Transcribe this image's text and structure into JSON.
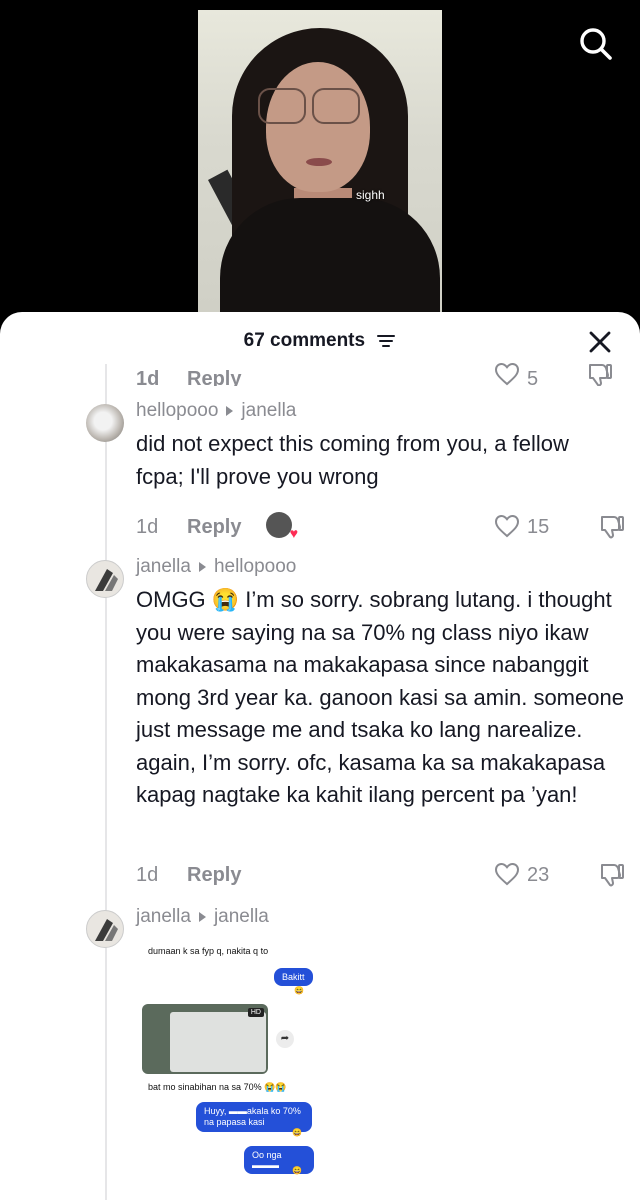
{
  "video": {
    "caption": "sighh"
  },
  "icons": {
    "search": "search-icon",
    "close": "close-icon",
    "filter": "filter-icon",
    "heart": "heart-icon",
    "dislike": "dislike-icon"
  },
  "colors": {
    "accent": "#fe2c55",
    "muted": "#8a8b91",
    "text": "#161823",
    "message_out": "#2450d8"
  },
  "sheet": {
    "title": "67 comments"
  },
  "cut_row": {
    "time": "1d",
    "reply": "Reply",
    "count": "5"
  },
  "comments": [
    {
      "user": "hellopooo",
      "reply_to": "janella",
      "text": "did not expect this coming from you, a fellow fcpa; I'll prove you wrong",
      "time": "1d",
      "reply": "Reply",
      "likes": "15",
      "creator_liked": true
    },
    {
      "user": "janella",
      "reply_to": "hellopooo",
      "text": "OMGG 😭 I’m so sorry. sobrang lutang. i thought you were saying na sa 70% ng class niyo ikaw makakasama na makakapasa since nabanggit mong 3rd year ka. ganoon kasi sa amin. someone just message me and tsaka ko lang narealize. again, I’m sorry. ofc, kasama ka sa makakapasa kapag nagtake ka kahit ilang percent pa ’yan!",
      "time": "1d",
      "reply": "Reply",
      "likes": "23"
    },
    {
      "user": "janella",
      "reply_to": "janella"
    }
  ],
  "screenshot_messages": {
    "m1": "dumaan k sa fyp q, nakita q to",
    "m2": "Bakitt",
    "m3": "bat mo sinabihan na sa 70% 😭😭",
    "m4": "Huyy, ▬▬akala ko 70% na papasa kasi",
    "m5": "Oo nga ▬▬▬",
    "hd": "HD"
  }
}
